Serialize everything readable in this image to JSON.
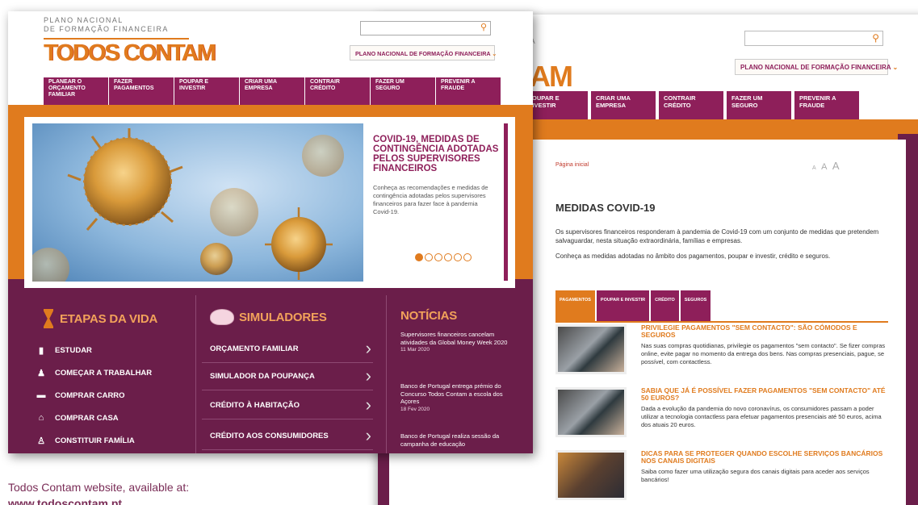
{
  "logo": {
    "top_line_1": "PLANO NACIONAL",
    "top_line_2": "DE FORMAÇÃO FINANCEIRA",
    "wordmark": "TODOS CONTAM",
    "wordmark_fragment": "AM"
  },
  "search": {
    "icon": "search-icon"
  },
  "plano_button": "PLANO NACIONAL DE FORMAÇÃO FINANCEIRA",
  "nav": [
    "PLANEAR O ORÇAMENTO FAMILIAR",
    "FAZER PAGAMENTOS",
    "POUPAR E INVESTIR",
    "CRIAR UMA EMPRESA",
    "CONTRAIR CRÉDITO",
    "FAZER UM SEGURO",
    "PREVENIR A FRAUDE"
  ],
  "hero": {
    "title": "COVID-19, MEDIDAS DE CONTINGÊNCIA ADOTADAS PELOS SUPERVISORES FINANCEIROS",
    "body": "Conheça as recomendações e medidas de contingência adotadas pelos supervisores financeiros para fazer face à pandemia Covid-19.",
    "slides": 6,
    "active_slide": 1
  },
  "etapas": {
    "heading": "ETAPAS DA VIDA",
    "items": [
      {
        "label": "ESTUDAR",
        "icon": "book-icon"
      },
      {
        "label": "COMEÇAR A TRABALHAR",
        "icon": "people-icon"
      },
      {
        "label": "COMPRAR CARRO",
        "icon": "car-icon"
      },
      {
        "label": "COMPRAR CASA",
        "icon": "house-icon"
      },
      {
        "label": "CONSTITUIR FAMÍLIA",
        "icon": "family-icon"
      }
    ]
  },
  "simuladores": {
    "heading": "SIMULADORES",
    "items": [
      "ORÇAMENTO FAMILIAR",
      "SIMULADOR DA POUPANÇA",
      "CRÉDITO À HABITAÇÃO",
      "CRÉDITO AOS CONSUMIDORES"
    ]
  },
  "noticias": {
    "heading": "NOTÍCIAS",
    "items": [
      {
        "text": "Supervisores financeiros cancelam atividades da Global Money Week 2020",
        "date": "11 Mar 2020"
      },
      {
        "text": "Banco de Portugal entrega prémio do Concurso Todos Contam a escola dos Açores",
        "date": "18 Fev 2020"
      },
      {
        "text": "Banco de Portugal realiza sessão da campanha de educação",
        "date": ""
      }
    ]
  },
  "page": {
    "breadcrumb": "Página inicial",
    "font_controls": [
      "A",
      "A",
      "A"
    ],
    "title": "MEDIDAS COVID-19",
    "intro_1": "Os supervisores financeiros responderam à pandemia de Covid-19 com um conjunto de medidas que pretendem salvaguardar, nesta situação extraordinária, famílias e empresas.",
    "intro_2": "Conheça as medidas adotadas no âmbito dos pagamentos, poupar e investir, crédito e seguros.",
    "tabs": [
      "PAGAMENTOS",
      "POUPAR E INVESTIR",
      "CRÉDITO",
      "SEGUROS"
    ],
    "articles": [
      {
        "title": "PRIVILEGIE PAGAMENTOS \"SEM CONTACTO\": SÃO CÓMODOS E SEGUROS",
        "text": "Nas suas compras quotidianas, privilegie os pagamentos \"sem contacto\". Se fizer compras online, evite pagar no momento da entrega dos bens. Nas compras presenciais, pague, se possível, com contactless."
      },
      {
        "title": "SABIA QUE JÁ É POSSÍVEL FAZER PAGAMENTOS \"SEM CONTACTO\" ATÉ 50 EUROS?",
        "text": "Dada a evolução da pandemia do novo coronavírus, os consumidores passam a poder utilizar a tecnologia contactless para efetuar pagamentos presenciais até 50 euros, acima dos atuais 20 euros."
      },
      {
        "title": "DICAS PARA SE PROTEGER QUANDO ESCOLHE SERVIÇOS BANCÁRIOS NOS CANAIS DIGITAIS",
        "text": "Saiba como fazer uma utilização segura dos canais digitais para aceder aos serviços bancários!"
      }
    ]
  },
  "caption": {
    "line": "Todos Contam website, available at:",
    "url": "www.todoscontam.pt"
  },
  "colors": {
    "orange": "#e07b1e",
    "purple": "#8e1f5a",
    "dark_purple": "#6b1e4a"
  }
}
